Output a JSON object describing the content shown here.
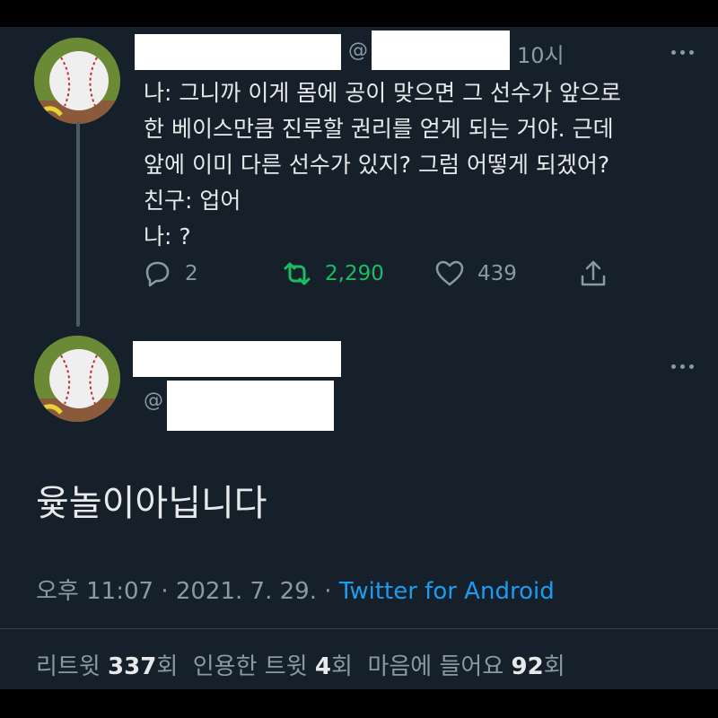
{
  "tweet1": {
    "at_symbol": "@",
    "time": "10시",
    "lines": [
      "나: 그니까 이게 몸에 공이 맞으면 그 선수가 앞으로",
      "한 베이스만큼 진루할 권리를 얻게 되는 거야. 근데",
      "앞에 이미 다른 선수가 있지? 그럼 어떻게 되겠어?",
      "친구: 업어",
      "나: ?"
    ],
    "replies": "2",
    "retweets": "2,290",
    "likes": "439"
  },
  "tweet2": {
    "at_symbol": "@",
    "text": "윷놀이아닙니다",
    "time": "오후 11:07",
    "date": "2021. 7. 29.",
    "separator": "·",
    "source": "Twitter for Android",
    "stats": {
      "retweet_label": "리트윗",
      "retweet_count": "337",
      "quote_label": "인용한 트윗",
      "quote_count": "4",
      "like_label": "마음에 들어요",
      "like_count": "92",
      "unit": "회"
    }
  },
  "colors": {
    "background": "#15202b",
    "text": "#e7e9ea",
    "muted": "#8b98a5",
    "retweet_green": "#17bf63",
    "link_blue": "#1d9bf0"
  }
}
